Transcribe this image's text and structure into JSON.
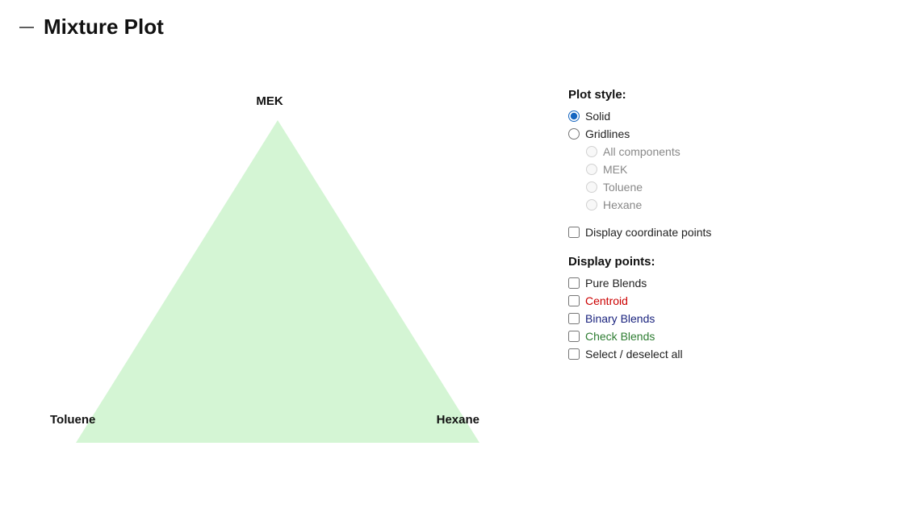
{
  "header": {
    "dash": "—",
    "title": "Mixture Plot"
  },
  "plot": {
    "label_top": "MEK",
    "label_bottom_left": "Toluene",
    "label_bottom_right": "Hexane",
    "triangle_fill": "#d4f5d4",
    "triangle_stroke": "none"
  },
  "controls": {
    "plot_style_title": "Plot style:",
    "plot_styles": [
      {
        "id": "solid",
        "label": "Solid",
        "checked": true,
        "indented": false
      },
      {
        "id": "gridlines",
        "label": "Gridlines",
        "checked": false,
        "indented": false
      }
    ],
    "gridline_options": [
      {
        "id": "all_components",
        "label": "All components",
        "disabled": true
      },
      {
        "id": "mek",
        "label": "MEK",
        "disabled": true
      },
      {
        "id": "toluene",
        "label": "Toluene",
        "disabled": true
      },
      {
        "id": "hexane",
        "label": "Hexane",
        "disabled": true
      }
    ],
    "display_coord_label": "Display coordinate points",
    "display_points_title": "Display points:",
    "display_points": [
      {
        "id": "pure_blends",
        "label": "Pure Blends",
        "color": "default",
        "checked": false
      },
      {
        "id": "centroid",
        "label": "Centroid",
        "color": "red",
        "checked": false
      },
      {
        "id": "binary_blends",
        "label": "Binary Blends",
        "color": "blue",
        "checked": false
      },
      {
        "id": "check_blends",
        "label": "Check Blends",
        "color": "green",
        "checked": false
      },
      {
        "id": "select_deselect",
        "label": "Select / deselect all",
        "color": "default",
        "checked": false
      }
    ]
  }
}
